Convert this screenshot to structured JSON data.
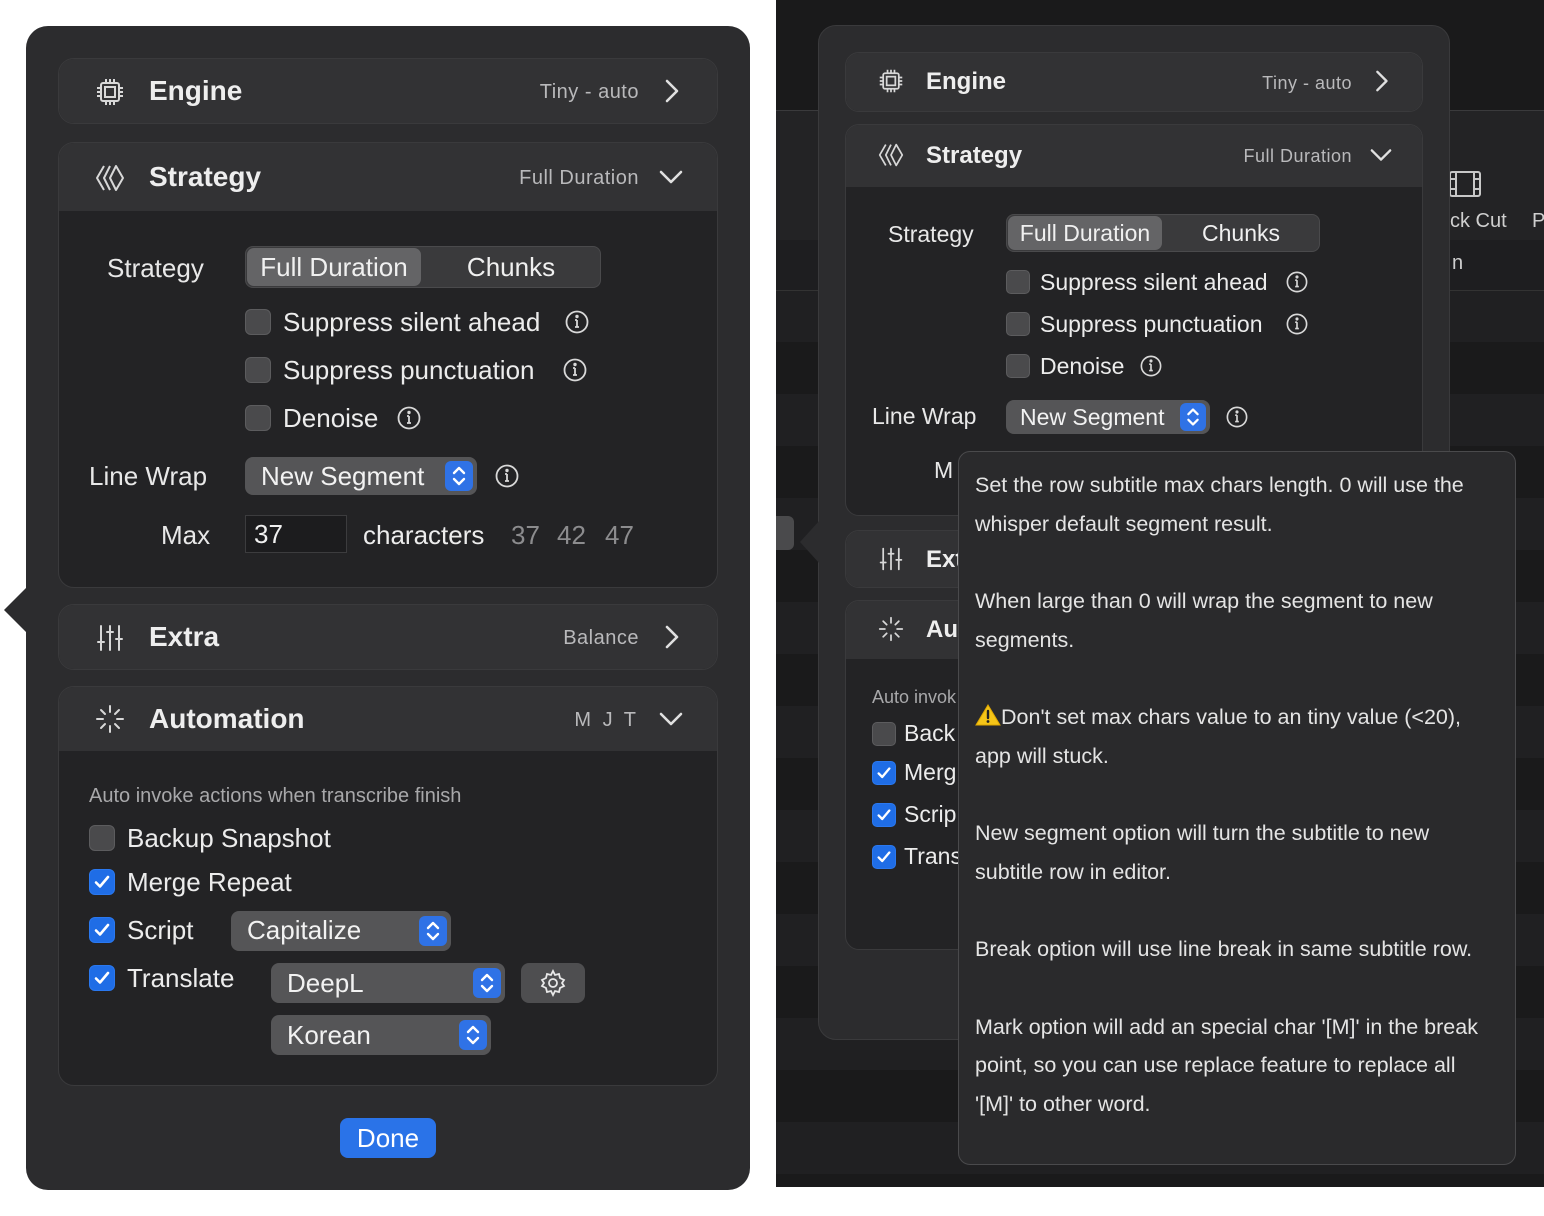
{
  "left": {
    "engine": {
      "title": "Engine",
      "value": "Tiny - auto",
      "icon": "cpu-icon"
    },
    "strategy": {
      "title": "Strategy",
      "value": "Full Duration",
      "icon": "strategy-icon",
      "strategy_label": "Strategy",
      "segment_options": [
        "Full Duration",
        "Chunks"
      ],
      "selected_option": "Full Duration",
      "checkboxes": [
        {
          "label": "Suppress silent ahead",
          "checked": false
        },
        {
          "label": "Suppress punctuation",
          "checked": false
        },
        {
          "label": "Denoise",
          "checked": false
        }
      ],
      "line_wrap_label": "Line Wrap",
      "line_wrap_value": "New Segment",
      "max_label": "Max",
      "max_value": "37",
      "max_unit": "characters",
      "presets": [
        "37",
        "42",
        "47"
      ]
    },
    "extra": {
      "title": "Extra",
      "value": "Balance",
      "icon": "sliders-icon"
    },
    "automation": {
      "title": "Automation",
      "value": "M J T",
      "icon": "sparkle-icon",
      "description": "Auto invoke actions when transcribe finish",
      "items": [
        {
          "label": "Backup Snapshot",
          "checked": false
        },
        {
          "label": "Merge Repeat",
          "checked": true
        },
        {
          "label": "Script",
          "checked": true
        },
        {
          "label": "Translate",
          "checked": true
        }
      ],
      "script_value": "Capitalize",
      "translate_engine": "DeepL",
      "translate_language": "Korean"
    },
    "done_label": "Done"
  },
  "right": {
    "engine": {
      "title": "Engine",
      "value": "Tiny - auto"
    },
    "strategy": {
      "title": "Strategy",
      "value": "Full Duration",
      "strategy_label": "Strategy",
      "segment_options": [
        "Full Duration",
        "Chunks"
      ],
      "checkboxes": [
        {
          "label": "Suppress silent ahead",
          "checked": false
        },
        {
          "label": "Suppress punctuation",
          "checked": false
        },
        {
          "label": "Denoise",
          "checked": false
        }
      ],
      "line_wrap_label": "Line Wrap",
      "line_wrap_value": "New Segment",
      "max_label_partial": "M"
    },
    "extra_partial": "Ext",
    "automation_partial": "Au",
    "automation_desc_partial": "Auto invok",
    "automation_items_partial": [
      {
        "label": "Back",
        "checked": false
      },
      {
        "label": "Merg",
        "checked": true
      },
      {
        "label": "Scrip",
        "checked": true
      },
      {
        "label": "Trans",
        "checked": true
      }
    ],
    "background_toolbar": {
      "item_label_partial": "ck Cut",
      "trailing_partial": "P",
      "row_partial": "n"
    },
    "tooltip": {
      "p1": "Set the row subtitle max chars length. 0 will use the whisper default segment result.",
      "p2": "When large than 0 will wrap the segment to new segments.",
      "p3": "Don't set max chars value to an tiny value (<20), app will stuck.",
      "p4": "New segment option will turn the subtitle to new subtitle row in editor.",
      "p5": "Break option will use line break in same subtitle row.",
      "p6": "Mark option will add an special char '[M]' in the break point, so you can use replace feature to replace all '[M]' to other word."
    }
  }
}
